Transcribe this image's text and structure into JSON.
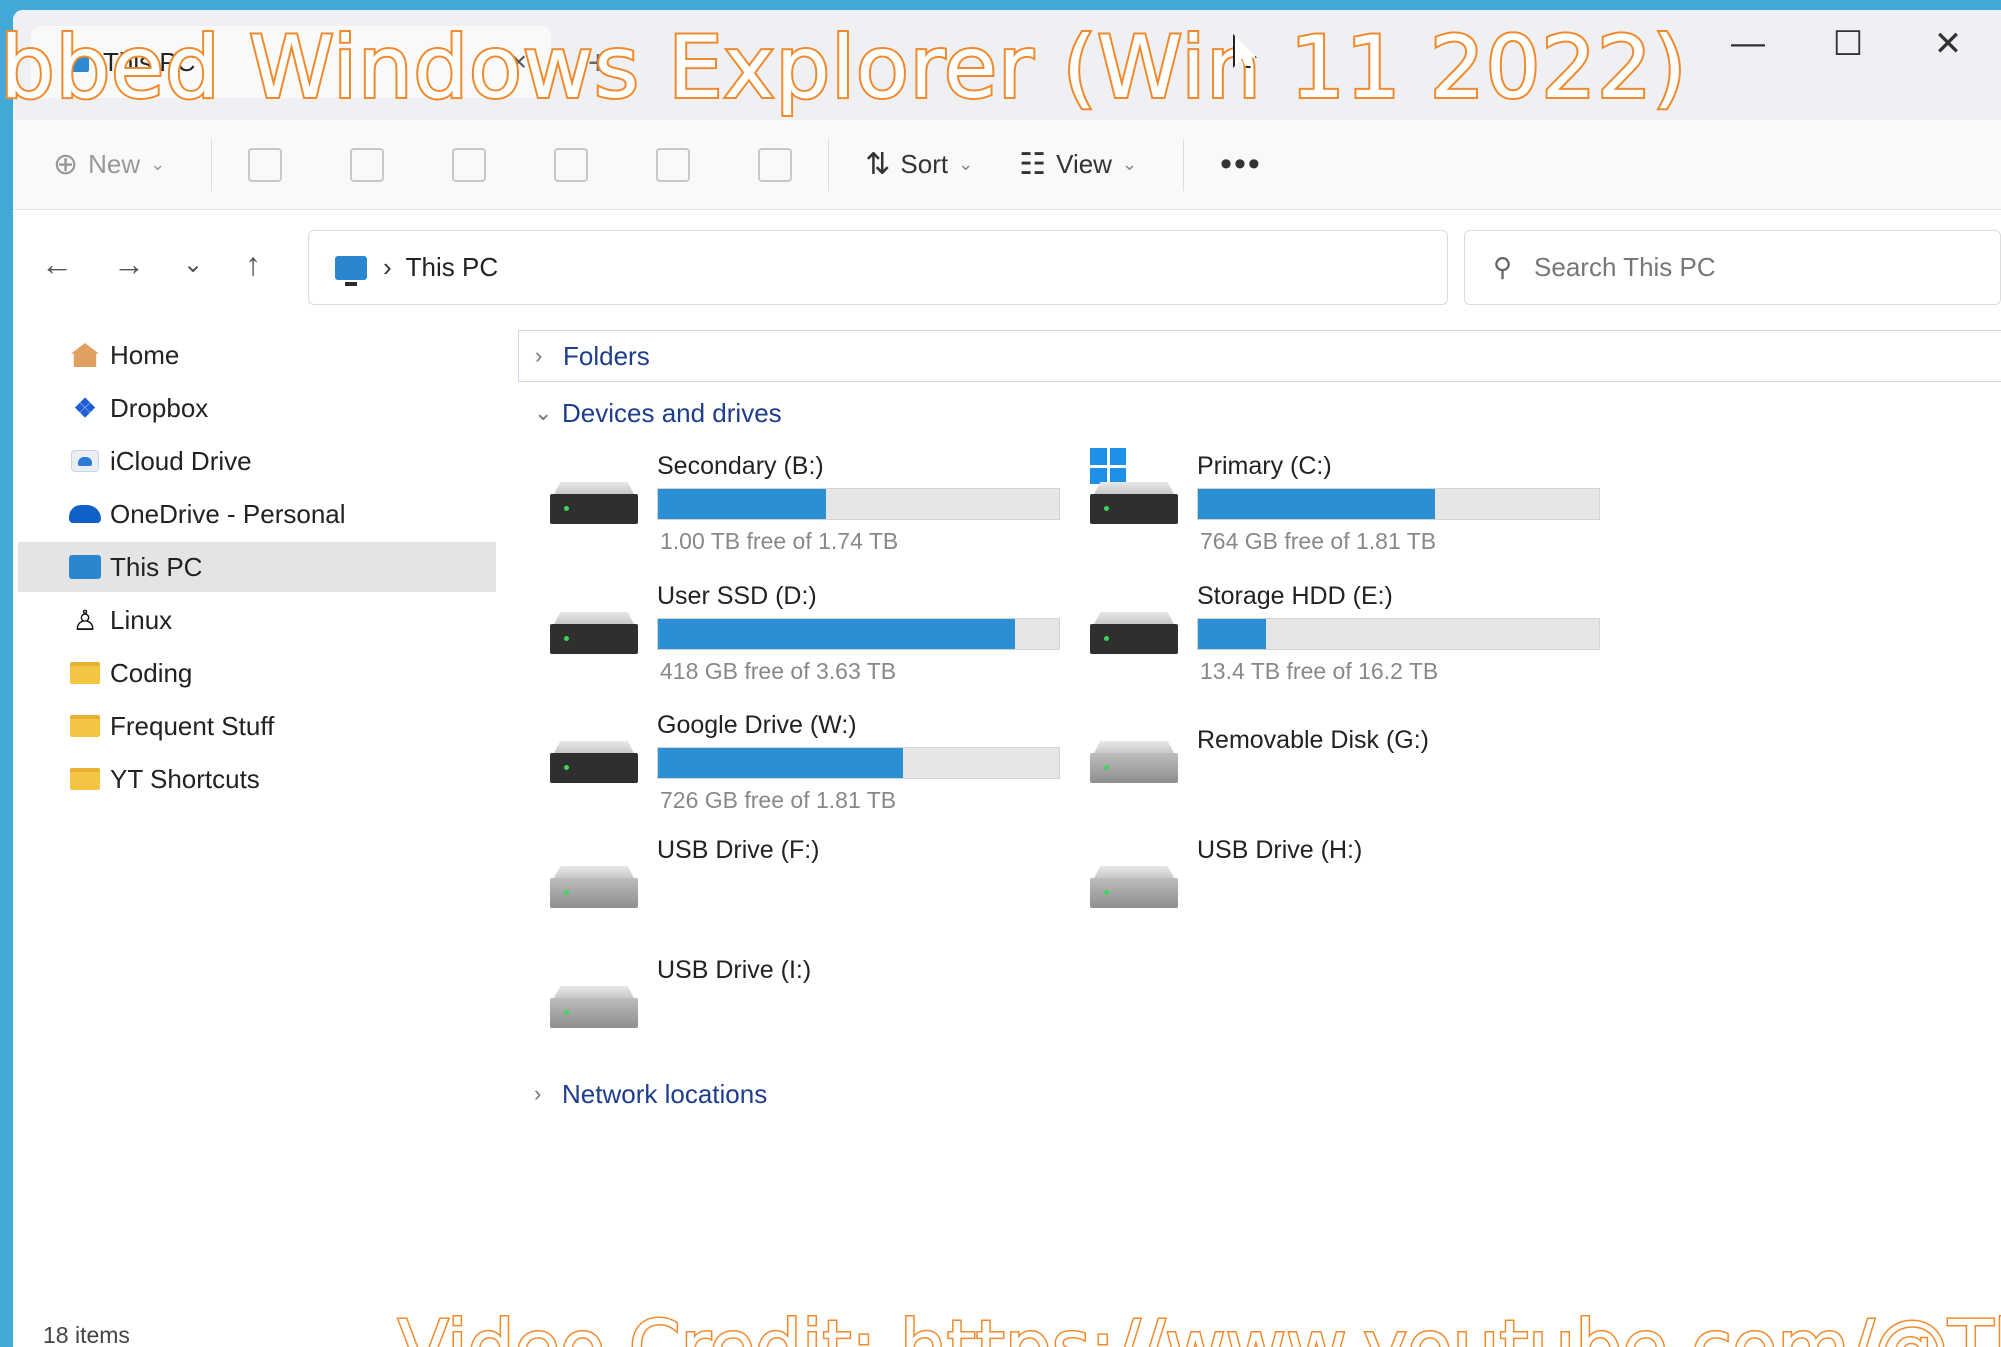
{
  "window": {
    "tab_title": "This PC",
    "tab_close": "×",
    "new_tab": "+",
    "minimize": "—",
    "maximize": "☐",
    "close": "✕"
  },
  "toolbar": {
    "new_label": "New",
    "sort_label": "Sort",
    "view_label": "View",
    "more_label": "•••"
  },
  "address": {
    "crumb": "This PC",
    "search_placeholder": "Search This PC"
  },
  "sidebar": {
    "items": [
      {
        "label": "Home",
        "icon": "home-icon"
      },
      {
        "label": "Dropbox",
        "icon": "dropbox-icon"
      },
      {
        "label": "iCloud Drive",
        "icon": "icloud-icon"
      },
      {
        "label": "OneDrive - Personal",
        "icon": "onedrive-icon"
      },
      {
        "label": "This PC",
        "icon": "pc-icon",
        "selected": true
      },
      {
        "label": "Linux",
        "icon": "linux-icon"
      },
      {
        "label": "Coding",
        "icon": "folder-icon"
      },
      {
        "label": "Frequent Stuff",
        "icon": "folder-icon"
      },
      {
        "label": "YT Shortcuts",
        "icon": "folder-icon"
      }
    ]
  },
  "main": {
    "folders_header": "Folders",
    "devices_header": "Devices and drives",
    "network_header": "Network locations",
    "drives": [
      {
        "name": "Secondary (B:)",
        "free": "1.00 TB free of 1.74 TB",
        "used_fraction": 0.42
      },
      {
        "name": "Primary (C:)",
        "free": "764 GB free of 1.81 TB",
        "used_fraction": 0.59
      },
      {
        "name": "User SSD (D:)",
        "free": "418 GB free of 3.63 TB",
        "used_fraction": 0.89
      },
      {
        "name": "Storage HDD (E:)",
        "free": "13.4 TB free of 16.2 TB",
        "used_fraction": 0.17
      },
      {
        "name": "Google Drive (W:)",
        "free": "726 GB free of 1.81 TB",
        "used_fraction": 0.61
      },
      {
        "name": "Removable Disk (G:)"
      },
      {
        "name": "USB Drive (F:)"
      },
      {
        "name": "USB Drive (H:)"
      },
      {
        "name": "USB Drive (I:)"
      }
    ]
  },
  "status": {
    "items_count": "18 items"
  },
  "overlay": {
    "title": "bbed Windows Explorer (Win 11 2022)",
    "credit": "Video Credit: https://www.youtube.com/@Th"
  }
}
